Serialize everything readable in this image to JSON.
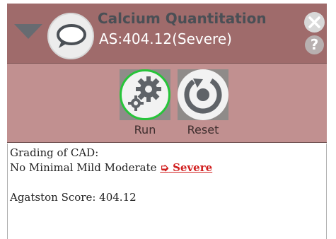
{
  "header": {
    "title": "Calcium Quantitation",
    "subtitle": "AS:404.12(Severe)",
    "help_label": "?"
  },
  "toolbar": {
    "run_label": "Run",
    "reset_label": "Reset"
  },
  "result": {
    "grading_heading": "Grading of CAD:",
    "grades_prefix": "No Minimal Mild Moderate",
    "selected_arrow": "➭",
    "selected_grade": "Severe",
    "score_text": "Agatston Score: 404.12"
  },
  "colors": {
    "header_bg": "#9f6b6b",
    "toolbar_bg": "#c19090",
    "selected_grade": "#d11f1f",
    "run_ring": "#27c43a"
  },
  "icons": {
    "collapse": "triangle-down-icon",
    "app": "speech-bubble-icon",
    "close": "close-icon",
    "help": "question-icon",
    "run": "gears-icon",
    "reset": "reset-icon"
  }
}
